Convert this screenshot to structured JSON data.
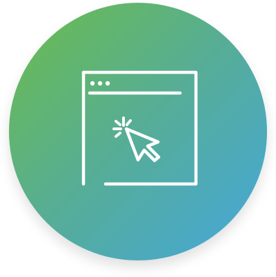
{
  "icon": {
    "name": "browser-window-click-icon",
    "description_role": "app-icon"
  },
  "colors": {
    "gradient_start": "#6cbc4a",
    "gradient_mid": "#56ad97",
    "gradient_end": "#44a7dd",
    "stroke": "#ffffff"
  }
}
